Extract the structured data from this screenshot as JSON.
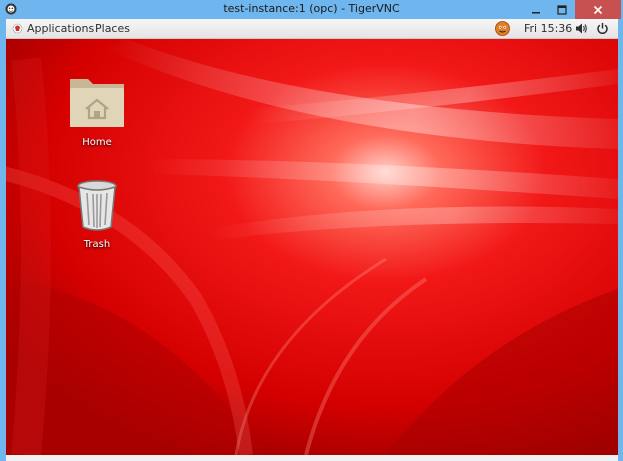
{
  "window": {
    "title": "test-instance:1 (opc) - TigerVNC",
    "icon": "tigervnc-icon",
    "controls": [
      "minimize-icon",
      "maximize-icon",
      "close-icon"
    ]
  },
  "panel": {
    "applications_label": "Applications",
    "places_label": "Places",
    "clock": "Fri 15:36",
    "tray": [
      "update-notifier-icon",
      "volume-icon",
      "power-icon"
    ]
  },
  "desktop": {
    "icons": [
      {
        "label": "Home",
        "icon": "home-folder-icon"
      },
      {
        "label": "Trash",
        "icon": "trash-icon"
      }
    ]
  },
  "colors": {
    "titlebar": "#6fb5ee",
    "close_button": "#c75050",
    "wallpaper_base": "#d40000"
  }
}
